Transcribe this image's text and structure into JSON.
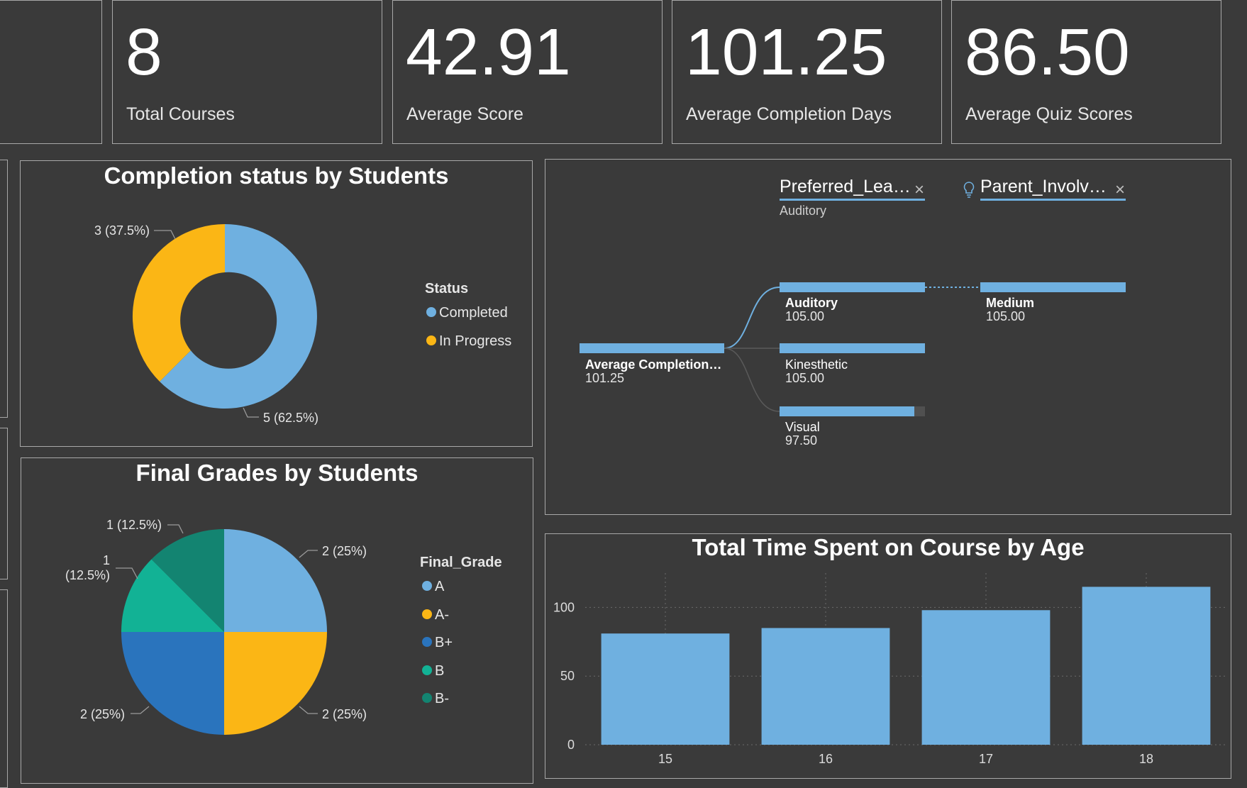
{
  "kpis": [
    {
      "value": "8",
      "label": "Total Courses"
    },
    {
      "value": "42.91",
      "label": "Average Score"
    },
    {
      "value": "101.25",
      "label": "Average Completion Days"
    },
    {
      "value": "86.50",
      "label": "Average Quiz Scores"
    }
  ],
  "colors": {
    "background": "#3a3a3a",
    "light_blue": "#6fb0e0",
    "yellow": "#fbb615",
    "dark_blue": "#2a74bd",
    "teal": "#12b295",
    "dark_teal": "#138471"
  },
  "completion_chart": {
    "title": "Completion status by Students",
    "legend_title": "Status",
    "legend": [
      "Completed",
      "In Progress"
    ],
    "labels": {
      "completed": "5 (62.5%)",
      "in_progress": "3 (37.5%)"
    }
  },
  "grades_chart": {
    "title": "Final Grades by Students",
    "legend_title": "Final_Grade",
    "legend": [
      "A",
      "A-",
      "B+",
      "B",
      "B-"
    ],
    "labels": {
      "a": "2 (25%)",
      "a_minus": "2 (25%)",
      "b_plus": "2 (25%)",
      "b_line1": "1",
      "b_line2": "(12.5%)",
      "b_minus": "1 (12.5%)"
    }
  },
  "decomp_tree": {
    "filters": [
      {
        "label": "Preferred_Lea…",
        "selected": "Auditory",
        "close_icon": "×"
      },
      {
        "label": "Parent_Involv…",
        "close_icon": "×",
        "icon": "lightbulb-icon"
      }
    ],
    "root": {
      "label": "Average Completion…",
      "value": "101.25"
    },
    "level1": [
      {
        "label": "Auditory",
        "value": "105.00"
      },
      {
        "label": "Kinesthetic",
        "value": "105.00"
      },
      {
        "label": "Visual",
        "value": "97.50"
      }
    ],
    "level2": [
      {
        "label": "Medium",
        "value": "105.00"
      }
    ]
  },
  "chart_data": {
    "type": "bar",
    "title": "Total Time Spent on Course by Age",
    "categories": [
      "15",
      "16",
      "17",
      "18"
    ],
    "values": [
      81,
      85,
      98,
      115
    ],
    "ylim": [
      0,
      125
    ],
    "yticks": [
      0,
      50,
      100
    ],
    "grid": true,
    "color": "#6fb0e0"
  }
}
